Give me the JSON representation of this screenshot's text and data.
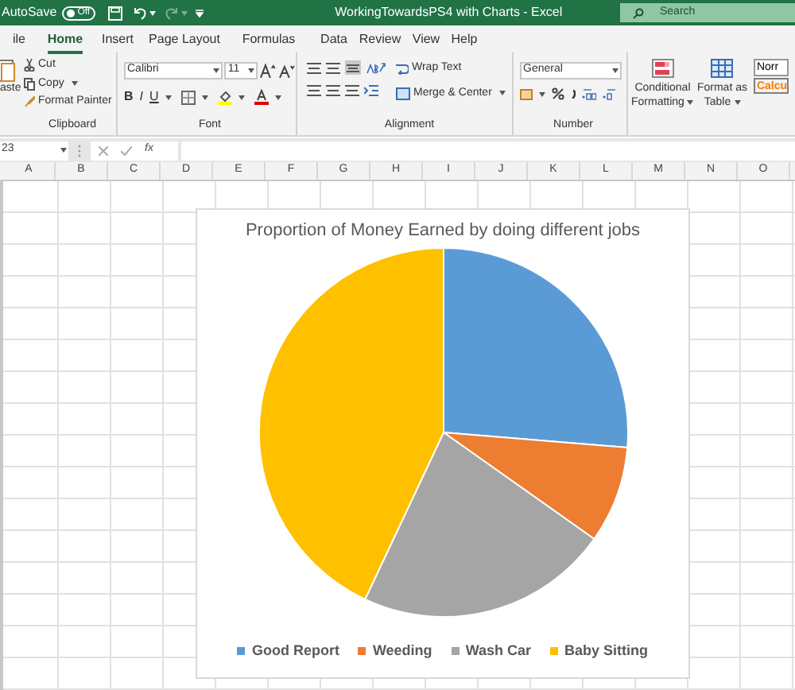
{
  "title_bar": {
    "autosave_label": "AutoSave",
    "autosave_toggle": {
      "label": "Off",
      "on": false
    },
    "title": "WorkingTowardsPS4 with Charts  -  Excel",
    "search_placeholder": "Search"
  },
  "tabs": [
    {
      "label": "ile",
      "selected": false
    },
    {
      "label": "Home",
      "selected": true
    },
    {
      "label": "Insert",
      "selected": false
    },
    {
      "label": "Page Layout",
      "selected": false
    },
    {
      "label": "Formulas",
      "selected": false
    },
    {
      "label": "Data",
      "selected": false
    },
    {
      "label": "Review",
      "selected": false
    },
    {
      "label": "View",
      "selected": false
    },
    {
      "label": "Help",
      "selected": false
    }
  ],
  "ribbon": {
    "clipboard": {
      "paste": "aste",
      "cut": "Cut",
      "copy": "Copy",
      "format_painter": "Format Painter",
      "label": "Clipboard"
    },
    "font": {
      "font_name": "Calibri",
      "font_size": "11",
      "bold": "B",
      "italic": "I",
      "underline": "U",
      "label": "Font"
    },
    "alignment": {
      "wrap_text": "Wrap Text",
      "merge_center": "Merge & Center",
      "label": "Alignment"
    },
    "number": {
      "format": "General",
      "label": "Number"
    },
    "styles": {
      "conditional_formatting": [
        "Conditional",
        "Formatting"
      ],
      "format_as_table": [
        "Format as",
        "Table"
      ],
      "style_normal": "Norr",
      "style_calculation": "Calcu"
    }
  },
  "formula_bar": {
    "name_box": "23",
    "fx": "fx"
  },
  "columns": [
    "A",
    "B",
    "C",
    "D",
    "E",
    "F",
    "G",
    "H",
    "I",
    "J",
    "K",
    "L",
    "M",
    "N",
    "O"
  ],
  "chart": {
    "title": "Proportion of Money Earned by doing different jobs",
    "legend": [
      {
        "label": "Good Report",
        "color": "#5b9bd5"
      },
      {
        "label": "Weeding",
        "color": "#ed7d31"
      },
      {
        "label": "Wash Car",
        "color": "#a5a5a5"
      },
      {
        "label": "Baby Sitting",
        "color": "#ffc000"
      }
    ]
  }
}
